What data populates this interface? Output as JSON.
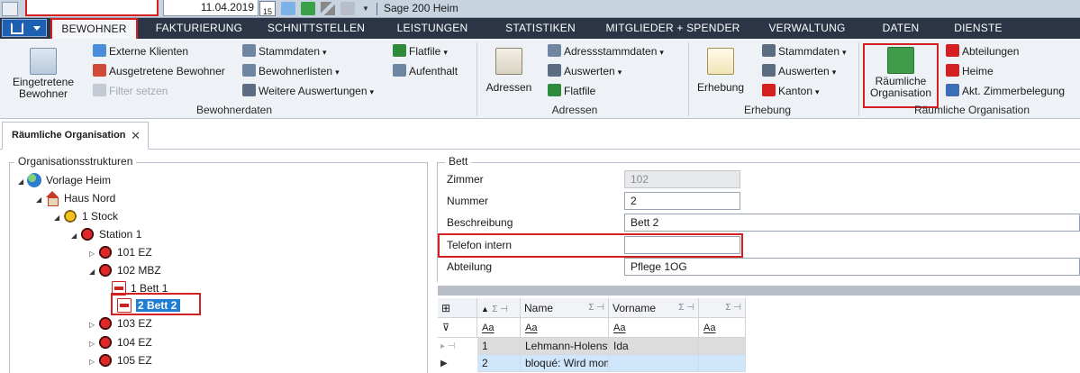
{
  "toolbar": {
    "date": "11.04.2019",
    "calendar_day": "15",
    "app_title": "Sage 200 Heim"
  },
  "menu": {
    "tabs": [
      {
        "label": "BEWOHNER"
      },
      {
        "label": "FAKTURIERUNG"
      },
      {
        "label": "SCHNITTSTELLEN"
      },
      {
        "label": "LEISTUNGEN"
      },
      {
        "label": "STATISTIKEN"
      },
      {
        "label": "MITGLIEDER + SPENDER"
      },
      {
        "label": "VERWALTUNG"
      },
      {
        "label": "DATEN"
      },
      {
        "label": "DIENSTE"
      }
    ]
  },
  "ribbon": {
    "bewohnerdaten": {
      "label": "Bewohnerdaten",
      "eingetretene": "Eingetretene\nBewohner",
      "externe": "Externe Klienten",
      "ausgetretene": "Ausgetretene Bewohner",
      "filter": "Filter setzen",
      "stammdaten": "Stammdaten",
      "bewohnerlisten": "Bewohnerlisten",
      "weitere": "Weitere Auswertungen",
      "flatfile": "Flatfile",
      "aufenthalt": "Aufenthalt"
    },
    "adressen": {
      "label": "Adressen",
      "adressen_btn": "Adressen",
      "adressstammdaten": "Adressstammdaten",
      "auswerten": "Auswerten",
      "flatfile": "Flatfile"
    },
    "erhebung": {
      "label": "Erhebung",
      "erhebung_btn": "Erhebung",
      "stammdaten": "Stammdaten",
      "auswerten": "Auswerten",
      "kanton": "Kanton"
    },
    "raeumliche": {
      "label": "Räumliche Organisation",
      "btn": "Räumliche\nOrganisation",
      "abteilungen": "Abteilungen",
      "heime": "Heime",
      "zimmerbelegung": "Akt. Zimmerbelegung"
    }
  },
  "doc_tab": {
    "label": "Räumliche Organisation",
    "close": "✕"
  },
  "tree": {
    "legend": "Organisationsstrukturen",
    "nodes": [
      {
        "label": "Vorlage Heim"
      },
      {
        "label": "Haus Nord"
      },
      {
        "label": "1 Stock"
      },
      {
        "label": "Station 1"
      },
      {
        "label": "101  EZ"
      },
      {
        "label": "102  MBZ"
      },
      {
        "label": "1  Bett 1"
      },
      {
        "label": "2  Bett 2"
      },
      {
        "label": "103  EZ"
      },
      {
        "label": "104  EZ"
      },
      {
        "label": "105  EZ"
      }
    ]
  },
  "bett": {
    "legend": "Bett",
    "fields": [
      {
        "label": "Zimmer",
        "value": "102"
      },
      {
        "label": "Nummer",
        "value": "2"
      },
      {
        "label": "Beschreibung",
        "value": "Bett 2"
      },
      {
        "label": "Telefon intern",
        "value": ""
      },
      {
        "label": "Abteilung",
        "value": "Pflege 1OG"
      }
    ]
  },
  "grid": {
    "columns": [
      "Name",
      "Vorname"
    ],
    "filter_placeholder": "Aa",
    "rows": [
      {
        "nr": "1",
        "name": "Lehmann-Holenstein",
        "vorname": "Ida"
      },
      {
        "nr": "2",
        "name": "bloqué: Wird momentan",
        "vorname": ""
      }
    ]
  },
  "colors": {
    "highlight_red": "#d42020",
    "menubar": "#2b3546",
    "selection": "#1f7ed4"
  }
}
